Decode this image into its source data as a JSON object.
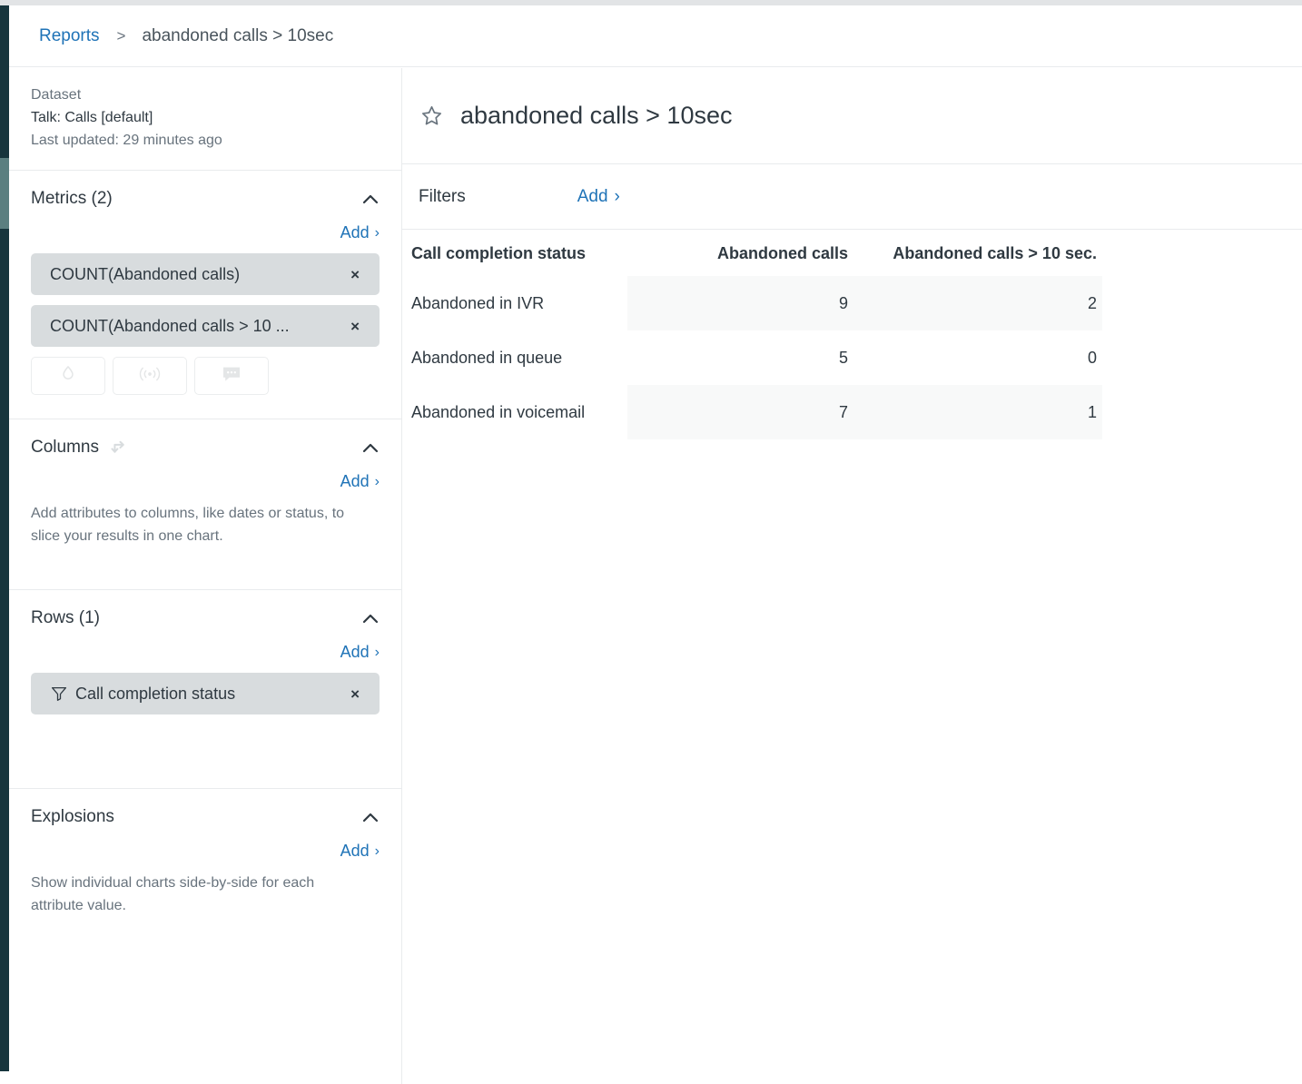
{
  "breadcrumb": {
    "root_label": "Reports",
    "separator": ">",
    "current_label": "abandoned calls > 10sec"
  },
  "sidebar": {
    "dataset": {
      "label": "Dataset",
      "name": "Talk: Calls [default]",
      "last_updated": "Last updated: 29 minutes ago"
    },
    "metrics": {
      "title": "Metrics (2)",
      "add_label": "Add",
      "add_chevron": "›",
      "collapse_icon": "chevron-up-icon",
      "chips": [
        {
          "label": "COUNT(Abandoned calls)",
          "remove_label": "×"
        },
        {
          "label": "COUNT(Abandoned calls > 10 ...",
          "remove_label": "×"
        }
      ],
      "icon_buttons": [
        {
          "name": "droplet-icon"
        },
        {
          "name": "broadcast-icon"
        },
        {
          "name": "comment-icon"
        }
      ]
    },
    "columns": {
      "title": "Columns",
      "transpose_icon": "transpose-icon",
      "add_label": "Add",
      "add_chevron": "›",
      "help": "Add attributes to columns, like dates or status, to slice your results in one chart."
    },
    "rows": {
      "title": "Rows (1)",
      "add_label": "Add",
      "add_chevron": "›",
      "chips": [
        {
          "label": "Call completion status",
          "icon": "filter-funnel-icon",
          "remove_label": "×"
        }
      ]
    },
    "explosions": {
      "title": "Explosions",
      "add_label": "Add",
      "add_chevron": "›",
      "help": "Show individual charts side-by-side for each attribute value."
    }
  },
  "main": {
    "title": "abandoned calls > 10sec",
    "star_icon": "star-outline-icon",
    "filters": {
      "label": "Filters",
      "add_label": "Add",
      "add_chevron": "›"
    }
  },
  "chart_data": {
    "type": "table",
    "title": "abandoned calls > 10sec",
    "columns": [
      "Call completion status",
      "Abandoned calls",
      "Abandoned calls > 10 sec."
    ],
    "rows": [
      {
        "label": "Abandoned in IVR",
        "abandoned_calls": 9,
        "abandoned_calls_over_10s": 2
      },
      {
        "label": "Abandoned in queue",
        "abandoned_calls": 5,
        "abandoned_calls_over_10s": 0
      },
      {
        "label": "Abandoned in voicemail",
        "abandoned_calls": 7,
        "abandoned_calls_over_10s": 1
      }
    ],
    "series": [
      {
        "name": "Abandoned calls",
        "values": [
          9,
          5,
          7
        ]
      },
      {
        "name": "Abandoned calls > 10 sec.",
        "values": [
          2,
          0,
          1
        ]
      }
    ],
    "categories": [
      "Abandoned in IVR",
      "Abandoned in queue",
      "Abandoned in voicemail"
    ]
  },
  "colors": {
    "accent_link": "#1f73b7",
    "nav_rail": "#17353d",
    "nav_rail_active": "#5b7f80",
    "chip_bg": "#d8dcde",
    "row_shade": "#f8f9f9",
    "text": "#2f3941",
    "muted_text": "#68737d"
  }
}
